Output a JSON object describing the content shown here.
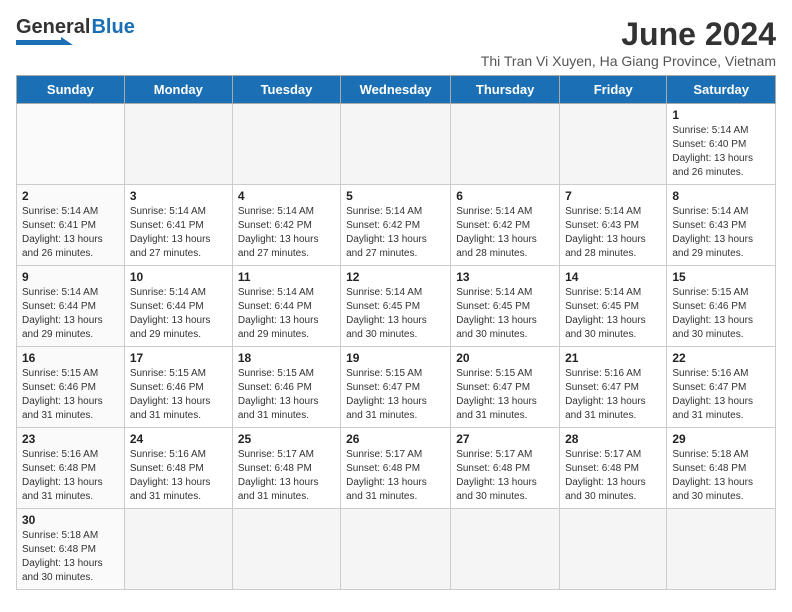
{
  "header": {
    "logo_general": "General",
    "logo_blue": "Blue",
    "title": "June 2024",
    "location": "Thi Tran Vi Xuyen, Ha Giang Province, Vietnam"
  },
  "days_of_week": [
    "Sunday",
    "Monday",
    "Tuesday",
    "Wednesday",
    "Thursday",
    "Friday",
    "Saturday"
  ],
  "weeks": [
    [
      {
        "day": "",
        "info": ""
      },
      {
        "day": "",
        "info": ""
      },
      {
        "day": "",
        "info": ""
      },
      {
        "day": "",
        "info": ""
      },
      {
        "day": "",
        "info": ""
      },
      {
        "day": "",
        "info": ""
      },
      {
        "day": "1",
        "info": "Sunrise: 5:14 AM\nSunset: 6:40 PM\nDaylight: 13 hours and 26 minutes."
      }
    ],
    [
      {
        "day": "2",
        "info": "Sunrise: 5:14 AM\nSunset: 6:41 PM\nDaylight: 13 hours and 26 minutes."
      },
      {
        "day": "3",
        "info": "Sunrise: 5:14 AM\nSunset: 6:41 PM\nDaylight: 13 hours and 27 minutes."
      },
      {
        "day": "4",
        "info": "Sunrise: 5:14 AM\nSunset: 6:42 PM\nDaylight: 13 hours and 27 minutes."
      },
      {
        "day": "5",
        "info": "Sunrise: 5:14 AM\nSunset: 6:42 PM\nDaylight: 13 hours and 27 minutes."
      },
      {
        "day": "6",
        "info": "Sunrise: 5:14 AM\nSunset: 6:42 PM\nDaylight: 13 hours and 28 minutes."
      },
      {
        "day": "7",
        "info": "Sunrise: 5:14 AM\nSunset: 6:43 PM\nDaylight: 13 hours and 28 minutes."
      },
      {
        "day": "8",
        "info": "Sunrise: 5:14 AM\nSunset: 6:43 PM\nDaylight: 13 hours and 29 minutes."
      }
    ],
    [
      {
        "day": "9",
        "info": "Sunrise: 5:14 AM\nSunset: 6:44 PM\nDaylight: 13 hours and 29 minutes."
      },
      {
        "day": "10",
        "info": "Sunrise: 5:14 AM\nSunset: 6:44 PM\nDaylight: 13 hours and 29 minutes."
      },
      {
        "day": "11",
        "info": "Sunrise: 5:14 AM\nSunset: 6:44 PM\nDaylight: 13 hours and 29 minutes."
      },
      {
        "day": "12",
        "info": "Sunrise: 5:14 AM\nSunset: 6:45 PM\nDaylight: 13 hours and 30 minutes."
      },
      {
        "day": "13",
        "info": "Sunrise: 5:14 AM\nSunset: 6:45 PM\nDaylight: 13 hours and 30 minutes."
      },
      {
        "day": "14",
        "info": "Sunrise: 5:14 AM\nSunset: 6:45 PM\nDaylight: 13 hours and 30 minutes."
      },
      {
        "day": "15",
        "info": "Sunrise: 5:15 AM\nSunset: 6:46 PM\nDaylight: 13 hours and 30 minutes."
      }
    ],
    [
      {
        "day": "16",
        "info": "Sunrise: 5:15 AM\nSunset: 6:46 PM\nDaylight: 13 hours and 31 minutes."
      },
      {
        "day": "17",
        "info": "Sunrise: 5:15 AM\nSunset: 6:46 PM\nDaylight: 13 hours and 31 minutes."
      },
      {
        "day": "18",
        "info": "Sunrise: 5:15 AM\nSunset: 6:46 PM\nDaylight: 13 hours and 31 minutes."
      },
      {
        "day": "19",
        "info": "Sunrise: 5:15 AM\nSunset: 6:47 PM\nDaylight: 13 hours and 31 minutes."
      },
      {
        "day": "20",
        "info": "Sunrise: 5:15 AM\nSunset: 6:47 PM\nDaylight: 13 hours and 31 minutes."
      },
      {
        "day": "21",
        "info": "Sunrise: 5:16 AM\nSunset: 6:47 PM\nDaylight: 13 hours and 31 minutes."
      },
      {
        "day": "22",
        "info": "Sunrise: 5:16 AM\nSunset: 6:47 PM\nDaylight: 13 hours and 31 minutes."
      }
    ],
    [
      {
        "day": "23",
        "info": "Sunrise: 5:16 AM\nSunset: 6:48 PM\nDaylight: 13 hours and 31 minutes."
      },
      {
        "day": "24",
        "info": "Sunrise: 5:16 AM\nSunset: 6:48 PM\nDaylight: 13 hours and 31 minutes."
      },
      {
        "day": "25",
        "info": "Sunrise: 5:17 AM\nSunset: 6:48 PM\nDaylight: 13 hours and 31 minutes."
      },
      {
        "day": "26",
        "info": "Sunrise: 5:17 AM\nSunset: 6:48 PM\nDaylight: 13 hours and 31 minutes."
      },
      {
        "day": "27",
        "info": "Sunrise: 5:17 AM\nSunset: 6:48 PM\nDaylight: 13 hours and 30 minutes."
      },
      {
        "day": "28",
        "info": "Sunrise: 5:17 AM\nSunset: 6:48 PM\nDaylight: 13 hours and 30 minutes."
      },
      {
        "day": "29",
        "info": "Sunrise: 5:18 AM\nSunset: 6:48 PM\nDaylight: 13 hours and 30 minutes."
      }
    ],
    [
      {
        "day": "30",
        "info": "Sunrise: 5:18 AM\nSunset: 6:48 PM\nDaylight: 13 hours and 30 minutes."
      },
      {
        "day": "",
        "info": ""
      },
      {
        "day": "",
        "info": ""
      },
      {
        "day": "",
        "info": ""
      },
      {
        "day": "",
        "info": ""
      },
      {
        "day": "",
        "info": ""
      },
      {
        "day": "",
        "info": ""
      }
    ]
  ]
}
